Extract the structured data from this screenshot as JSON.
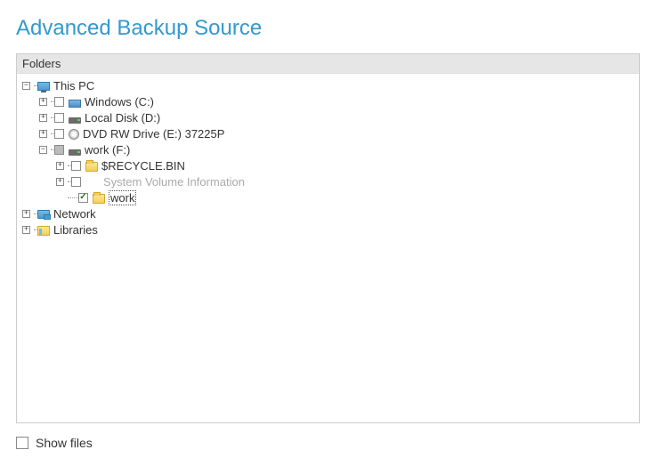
{
  "title": "Advanced Backup Source",
  "panel": {
    "header": "Folders"
  },
  "tree": {
    "this_pc": {
      "label": "This PC",
      "drives": {
        "c": {
          "label": "Windows  (C:)"
        },
        "d": {
          "label": "Local Disk (D:)"
        },
        "e": {
          "label": "DVD RW Drive (E:) 37225P"
        },
        "f": {
          "label": "work  (F:)",
          "children": {
            "recycle": {
              "label": "$RECYCLE.BIN"
            },
            "svi": {
              "label": "System Volume Information"
            },
            "work": {
              "label": "work"
            }
          }
        }
      }
    },
    "network": {
      "label": "Network"
    },
    "libraries": {
      "label": "Libraries"
    }
  },
  "showfiles": {
    "label": "Show files"
  },
  "exp": {
    "plus": "+",
    "minus": "−"
  }
}
